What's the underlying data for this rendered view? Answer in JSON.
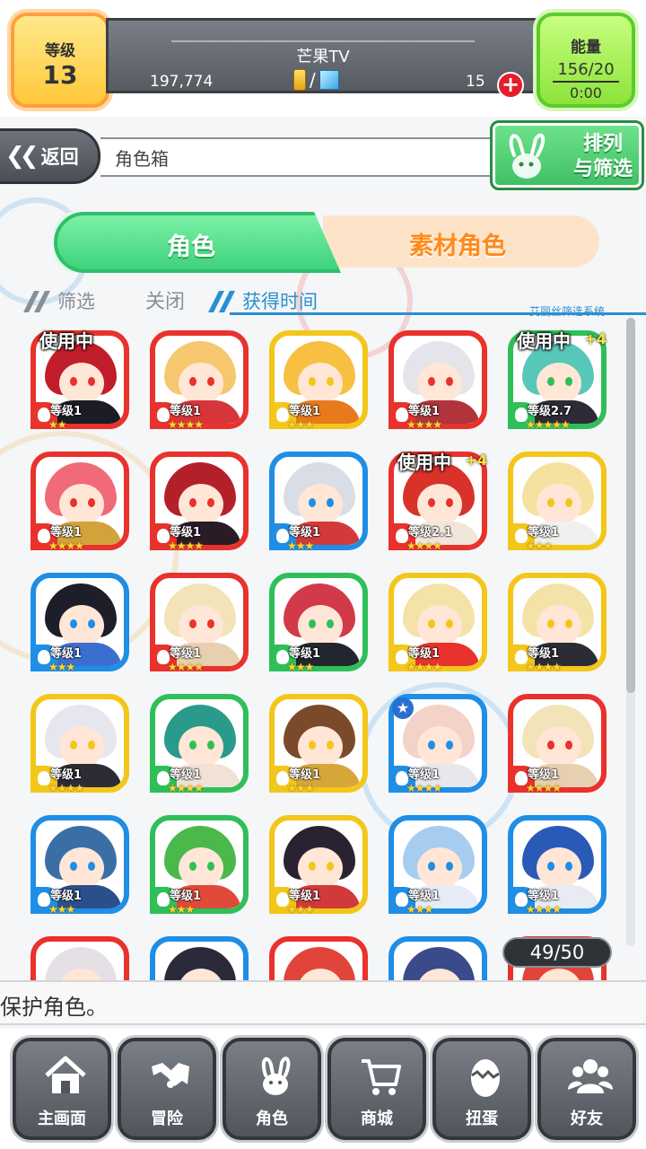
{
  "status": {
    "level_label": "等级",
    "level_value": "13",
    "player_name": "芒果TV",
    "gold": "197,774",
    "gems": "15",
    "currency_sep": "/",
    "energy_label": "能量",
    "energy_value": "156/20",
    "energy_timer": "0:00"
  },
  "nav": {
    "back_label": "返回",
    "page_title": "角色箱",
    "sort_label_1": "排列",
    "sort_label_2": "与筛选"
  },
  "tabs": {
    "role": "角色",
    "material": "素材角色"
  },
  "filter": {
    "filter_label": "筛选",
    "close_label": "关闭",
    "sort_by": "获得时间",
    "system_label": "艾丽丝筛选系统"
  },
  "cards": [
    {
      "elem": "fire",
      "frame": "#e8322b",
      "hair": "#c21d2a",
      "body": "#1c1c24",
      "level": "等级1",
      "stars": "★★",
      "inuse": "使用中",
      "plus": ""
    },
    {
      "elem": "fire",
      "frame": "#e8322b",
      "hair": "#f6c76f",
      "body": "#d6363a",
      "level": "等级1",
      "stars": "★★★★",
      "inuse": "",
      "plus": ""
    },
    {
      "elem": "thunder",
      "frame": "#f3c61a",
      "hair": "#f8c041",
      "body": "#e87a1c",
      "level": "等级1",
      "stars": "★★★",
      "inuse": "",
      "plus": ""
    },
    {
      "elem": "fire",
      "frame": "#e8322b",
      "hair": "#e4e4ea",
      "body": "#b1333c",
      "level": "等级1",
      "stars": "★★★★",
      "inuse": "",
      "plus": ""
    },
    {
      "elem": "wind",
      "frame": "#2fbf58",
      "hair": "#57c7b9",
      "body": "#2c2c36",
      "level": "等级2.7",
      "stars": "★★★★★",
      "inuse": "使用中",
      "plus": "+4"
    },
    {
      "elem": "fire",
      "frame": "#e8322b",
      "hair": "#f06a7a",
      "body": "#d2a33a",
      "level": "等级1",
      "stars": "★★★★",
      "inuse": "",
      "plus": ""
    },
    {
      "elem": "fire",
      "frame": "#e8322b",
      "hair": "#b4202a",
      "body": "#2b1b26",
      "level": "等级1",
      "stars": "★★★★",
      "inuse": "",
      "plus": ""
    },
    {
      "elem": "water",
      "frame": "#1e8ee6",
      "hair": "#d8dde6",
      "body": "#d23a3a",
      "level": "等级1",
      "stars": "★★★",
      "inuse": "",
      "plus": ""
    },
    {
      "elem": "fire",
      "frame": "#e8322b",
      "hair": "#d8322a",
      "body": "#f2e6da",
      "level": "等级2.1",
      "stars": "★★★★",
      "inuse": "使用中",
      "plus": "+4"
    },
    {
      "elem": "thunder",
      "frame": "#f3c61a",
      "hair": "#f5e2a0",
      "body": "#f0f0f0",
      "level": "等级1",
      "stars": "★★★",
      "inuse": "",
      "plus": ""
    },
    {
      "elem": "water",
      "frame": "#1e8ee6",
      "hair": "#1e1e2a",
      "body": "#3a6fd0",
      "level": "等级1",
      "stars": "★★★",
      "inuse": "",
      "plus": ""
    },
    {
      "elem": "fire",
      "frame": "#e8322b",
      "hair": "#f3e3b8",
      "body": "#e6d0b0",
      "level": "等级1",
      "stars": "★★★★",
      "inuse": "",
      "plus": ""
    },
    {
      "elem": "wind",
      "frame": "#2fbf58",
      "hair": "#d23a4a",
      "body": "#22262e",
      "level": "等级1",
      "stars": "★★★",
      "inuse": "",
      "plus": ""
    },
    {
      "elem": "thunder",
      "frame": "#f3c61a",
      "hair": "#f3e3a8",
      "body": "#e8322b",
      "level": "等级1",
      "stars": "★★★★",
      "inuse": "",
      "plus": ""
    },
    {
      "elem": "thunder",
      "frame": "#f3c61a",
      "hair": "#f3e3a8",
      "body": "#2c2c36",
      "level": "等级1",
      "stars": "★★★★",
      "inuse": "",
      "plus": ""
    },
    {
      "elem": "thunder",
      "frame": "#f3c61a",
      "hair": "#e6e6ee",
      "body": "#2c2c36",
      "level": "等级1",
      "stars": "★★★★",
      "inuse": "",
      "plus": ""
    },
    {
      "elem": "wind",
      "frame": "#2fbf58",
      "hair": "#2a9a8a",
      "body": "#f0e2d6",
      "level": "等级1",
      "stars": "★★★★",
      "inuse": "",
      "plus": ""
    },
    {
      "elem": "thunder",
      "frame": "#f3c61a",
      "hair": "#7a4a2a",
      "body": "#d6a63a",
      "level": "等级1",
      "stars": "★★★",
      "inuse": "",
      "plus": ""
    },
    {
      "elem": "water",
      "frame": "#1e8ee6",
      "hair": "#f3d2c8",
      "body": "#e6e8ee",
      "level": "等级1",
      "stars": "★★★★",
      "inuse": "",
      "plus": "",
      "badge": "★"
    },
    {
      "elem": "fire",
      "frame": "#e8322b",
      "hair": "#f3e3b8",
      "body": "#e6d0b0",
      "level": "等级1",
      "stars": "★★★★",
      "inuse": "",
      "plus": ""
    },
    {
      "elem": "water",
      "frame": "#1e8ee6",
      "hair": "#3a6fa6",
      "body": "#2a4f8a",
      "level": "等级1",
      "stars": "★★★",
      "inuse": "",
      "plus": ""
    },
    {
      "elem": "wind",
      "frame": "#2fbf58",
      "hair": "#4ab84a",
      "body": "#e04a3a",
      "level": "等级1",
      "stars": "★★★",
      "inuse": "",
      "plus": ""
    },
    {
      "elem": "thunder",
      "frame": "#f3c61a",
      "hair": "#2a2230",
      "body": "#d23a3a",
      "level": "等级1",
      "stars": "★★★",
      "inuse": "",
      "plus": ""
    },
    {
      "elem": "water",
      "frame": "#1e8ee6",
      "hair": "#a6cdf0",
      "body": "#e6ecf6",
      "level": "等级1",
      "stars": "★★★",
      "inuse": "",
      "plus": ""
    },
    {
      "elem": "water",
      "frame": "#1e8ee6",
      "hair": "#2a5ab8",
      "body": "#e8ecf2",
      "level": "等级1",
      "stars": "★★★★",
      "inuse": "",
      "plus": ""
    },
    {
      "elem": "fire",
      "frame": "#e8322b",
      "hair": "#e6e0e6",
      "body": "#ffffff",
      "level": "",
      "stars": "",
      "inuse": "",
      "plus": ""
    },
    {
      "elem": "water",
      "frame": "#1e8ee6",
      "hair": "#2a2a3a",
      "body": "#ffffff",
      "level": "",
      "stars": "",
      "inuse": "",
      "plus": ""
    },
    {
      "elem": "fire",
      "frame": "#e8322b",
      "hair": "#e0443a",
      "body": "#ffffff",
      "level": "",
      "stars": "",
      "inuse": "",
      "plus": ""
    },
    {
      "elem": "water",
      "frame": "#1e8ee6",
      "hair": "#3a4a8a",
      "body": "#ffffff",
      "level": "",
      "stars": "",
      "inuse": "",
      "plus": ""
    },
    {
      "elem": "fire",
      "frame": "#e8322b",
      "hair": "#e0443a",
      "body": "#ffffff",
      "level": "",
      "stars": "",
      "inuse": "",
      "plus": ""
    }
  ],
  "elem_colors": {
    "fire": "#e8322b",
    "water": "#1e8ee6",
    "thunder": "#f3c61a",
    "wind": "#2fbf58"
  },
  "box_count": "49/50",
  "message": "保护角色。",
  "bottom_nav": [
    {
      "label": "主画面",
      "icon": "home-icon"
    },
    {
      "label": "冒险",
      "icon": "handshake-icon"
    },
    {
      "label": "角色",
      "icon": "bunny-icon"
    },
    {
      "label": "商城",
      "icon": "cart-icon"
    },
    {
      "label": "扭蛋",
      "icon": "egg-icon"
    },
    {
      "label": "好友",
      "icon": "friends-icon"
    }
  ]
}
